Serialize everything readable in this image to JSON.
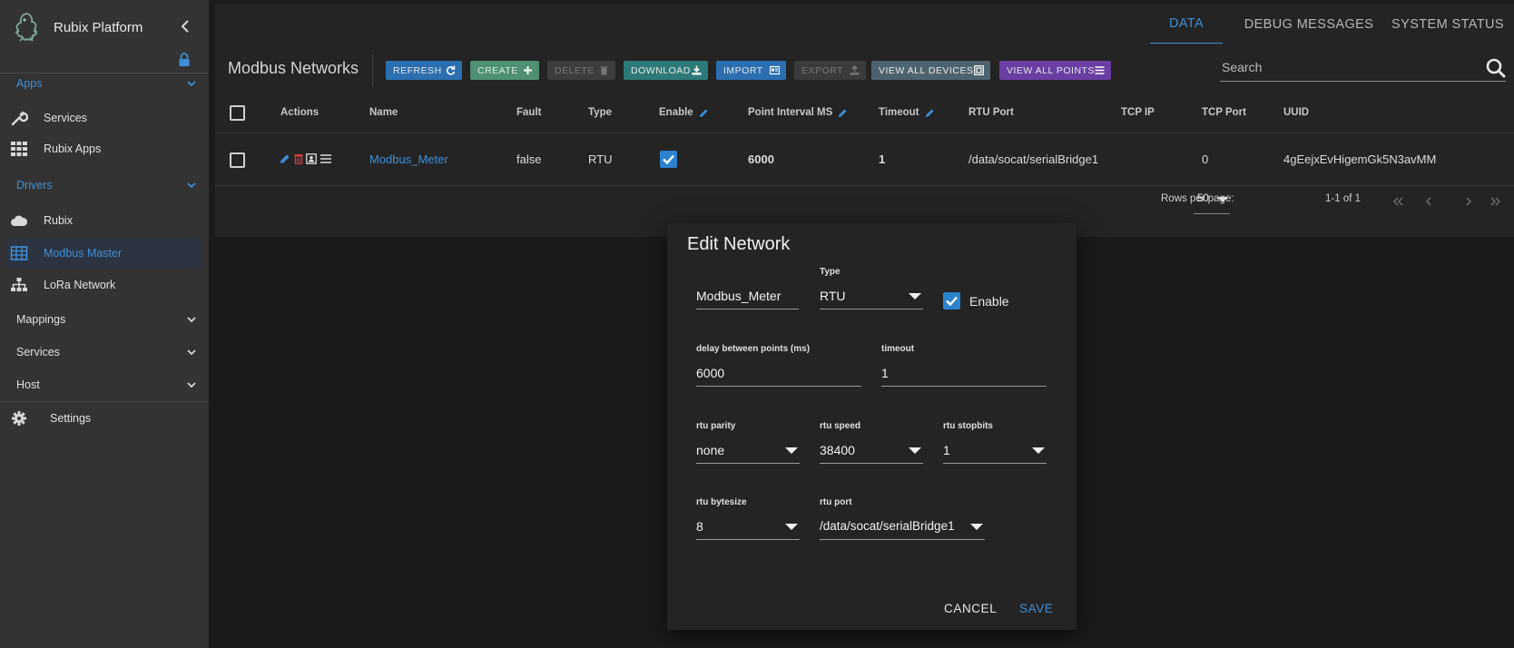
{
  "sidebar": {
    "brand": "Rubix Platform",
    "sections": {
      "apps": "Apps",
      "drivers": "Drivers",
      "mappings": "Mappings",
      "services": "Services",
      "host": "Host"
    },
    "items": {
      "services": "Services",
      "rubix_apps": "Rubix Apps",
      "rubix": "Rubix",
      "modbus_master": "Modbus Master",
      "lora_network": "LoRa Network",
      "settings": "Settings"
    }
  },
  "topnav": {
    "tabs": [
      "DATA",
      "DEBUG MESSAGES",
      "SYSTEM STATUS"
    ],
    "active": "DATA"
  },
  "toolbar": {
    "title": "Modbus Networks",
    "buttons": {
      "refresh": "REFRESH",
      "create": "CREATE",
      "delete": "DELETE",
      "download": "DOWNLOAD",
      "import": "IMPORT",
      "export": "EXPORT",
      "view_all_devices": "VIEW ALL DEVICES",
      "view_all_points": "VIEW ALL POINTS"
    },
    "search_placeholder": "Search"
  },
  "table": {
    "columns": {
      "actions": "Actions",
      "name": "Name",
      "fault": "Fault",
      "type": "Type",
      "enable": "Enable",
      "point_interval": "Point Interval MS",
      "timeout": "Timeout",
      "rtu_port": "RTU Port",
      "tcp_ip": "TCP IP",
      "tcp_port": "TCP Port",
      "uuid": "UUID"
    },
    "rows": [
      {
        "name": "Modbus_Meter",
        "fault": "false",
        "type": "RTU",
        "enabled": true,
        "point_interval": "6000",
        "timeout": "1",
        "rtu_port": "/data/socat/serialBridge1",
        "tcp_ip": "",
        "tcp_port": "0",
        "uuid": "4gEejxEvHigemGk5N3avMM"
      }
    ],
    "pagination": {
      "rows_per_page_label": "Rows per page:",
      "rows_per_page": "50",
      "range": "1-1 of 1"
    }
  },
  "dialog": {
    "title": "Edit Network",
    "name_value": "Modbus_Meter",
    "type_label": "Type",
    "type_value": "RTU",
    "enable_label": "Enable",
    "delay_label": "delay between points (ms)",
    "delay_value": "6000",
    "timeout_label": "timeout",
    "timeout_value": "1",
    "parity_label": "rtu parity",
    "parity_value": "none",
    "speed_label": "rtu speed",
    "speed_value": "38400",
    "stopbits_label": "rtu stopbits",
    "stopbits_value": "1",
    "bytesize_label": "rtu bytesize",
    "bytesize_value": "8",
    "port_label": "rtu port",
    "port_value": "/data/socat/serialBridge1",
    "cancel": "CANCEL",
    "save": "SAVE"
  },
  "colors": {
    "accent": "#3f8fd9",
    "refresh": "#2b6fb0",
    "create": "#4f8f72",
    "delete": "#3d3d3d",
    "download": "#2d7a78",
    "import": "#2b6fb0",
    "export": "#3a3a3a",
    "view_all_devices": "#4d6470",
    "view_all_points": "#6a3ea3"
  }
}
